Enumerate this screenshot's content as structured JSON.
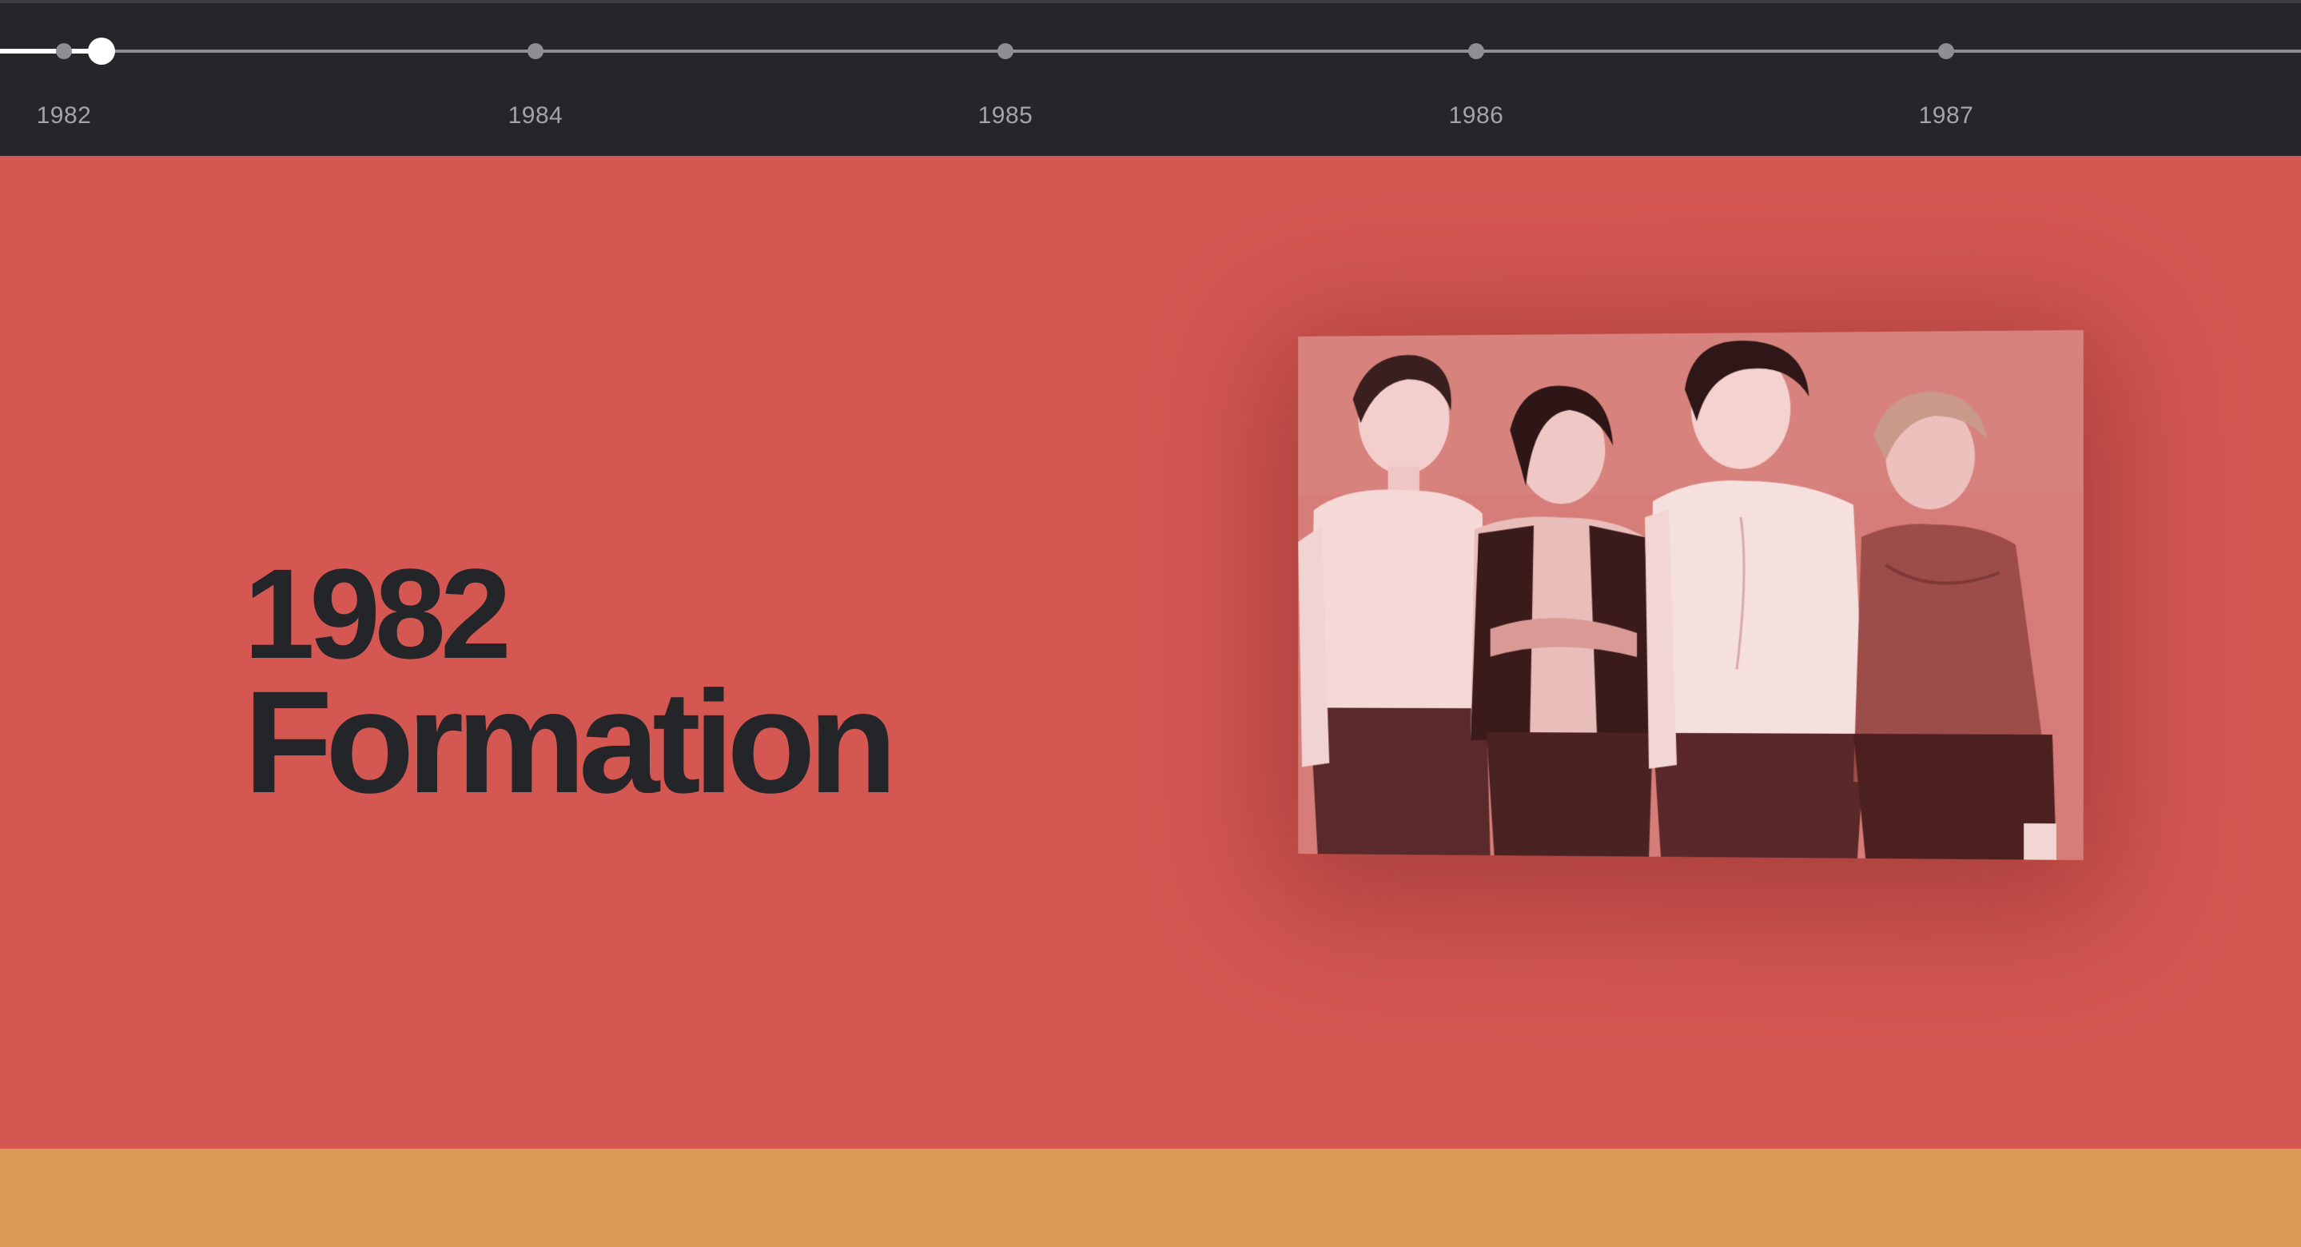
{
  "timeline": {
    "years": [
      "1982",
      "1984",
      "1985",
      "1986",
      "1987"
    ],
    "active_year": "1982",
    "progress_percent": 2.4
  },
  "main": {
    "year": "1982",
    "title": "Formation",
    "photo_alt": "Band photo"
  },
  "colors": {
    "timeline_bg": "#25262a",
    "section_bg": "#d55752",
    "next_section_bg": "#da9a58",
    "heading_text": "#242529",
    "tick_label": "#a3a4a8"
  }
}
